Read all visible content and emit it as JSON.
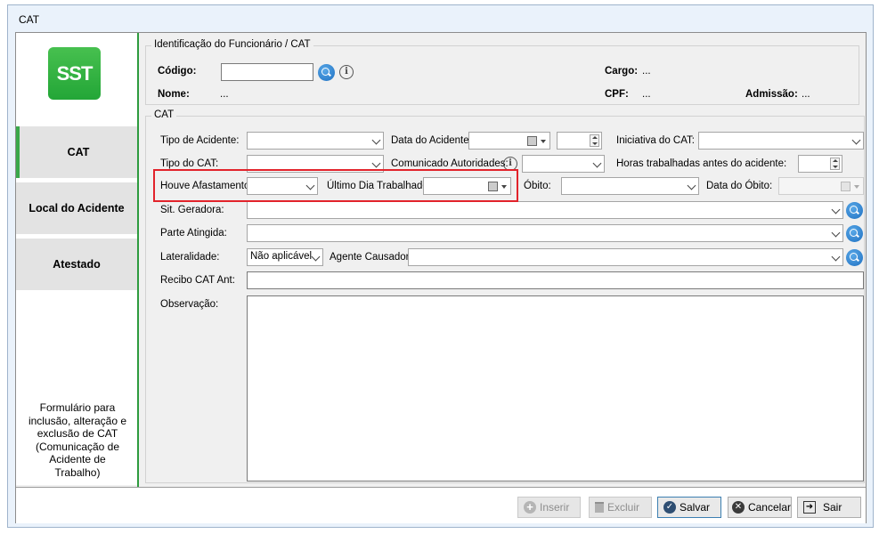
{
  "window": {
    "title": "CAT"
  },
  "sidebar": {
    "logo": "SST",
    "items": [
      {
        "label": "CAT",
        "active": true
      },
      {
        "label": "Local do Acidente",
        "active": false
      },
      {
        "label": "Atestado",
        "active": false
      }
    ],
    "description": "Formulário para\ninclusão, alteração e\nexclusão de CAT\n(Comunicação de\nAcidente de\nTrabalho)"
  },
  "employee": {
    "legend": "Identificação do Funcionário / CAT",
    "codigo_label": "Código:",
    "codigo_value": "",
    "nome_label": "Nome:",
    "nome_value": "...",
    "cargo_label": "Cargo:",
    "cargo_value": "...",
    "cpf_label": "CPF:",
    "cpf_value": "...",
    "admissao_label": "Admissão:",
    "admissao_value": "..."
  },
  "cat": {
    "legend": "CAT",
    "tipo_acidente": "Tipo de Acidente:",
    "data_acidente": "Data do Acidente:",
    "iniciativa": "Iniciativa do CAT:",
    "tipo_cat": "Tipo do CAT:",
    "comunicado": "Comunicado Autoridades:",
    "horas": "Horas trabalhadas antes do acidente:",
    "houve_afastamento": "Houve Afastamento:",
    "ultimo_dia": "Último Dia Trabalhado:",
    "obito": "Óbito:",
    "data_obito": "Data do Óbito:",
    "sit_geradora": "Sit. Geradora:",
    "parte_atingida": "Parte Atingida:",
    "lateralidade": "Lateralidade:",
    "lateralidade_value": "Não aplicável",
    "agente_causador": "Agente Causador:",
    "recibo": "Recibo CAT Ant:",
    "observacao": "Observação:"
  },
  "footer": {
    "inserir": "Inserir",
    "excluir": "Excluir",
    "salvar": "Salvar",
    "cancelar": "Cancelar",
    "sair": "Sair"
  },
  "colors": {
    "accent_green": "#2e9b3e",
    "highlight_red": "#e2232b",
    "search_blue": "#1d6fc1"
  }
}
